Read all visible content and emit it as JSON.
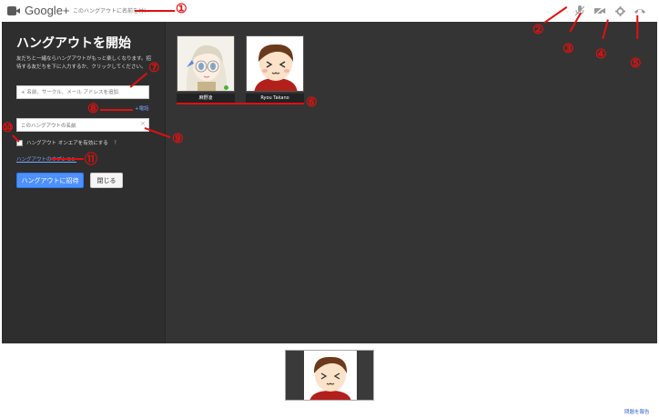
{
  "app": {
    "brand": "Google+"
  },
  "topbar": {
    "title_placeholder": "このハングアウトに名前を付ける",
    "dots": "· · · · · ·",
    "icons": [
      "microphone-off-icon",
      "camera-off-icon",
      "settings-gear-icon",
      "hangup-phone-icon"
    ]
  },
  "panel": {
    "title": "ハングアウトを開始",
    "description": "友だちと一緒ならハングアウトがもっと楽しくなります。招待する友だちを下に入力するか、クリックしてください。",
    "invite_placeholder": "+ 名前、サークル、メール アドレスを追加",
    "phone_link": "+電話",
    "name_value": "このハングアウトの名前",
    "onair_label": "ハングアウト オンエアを有効にする",
    "onair_help": "?",
    "options_link": "ハングアウトのオプション",
    "invite_button": "ハングアウトに招待",
    "close_button": "閉じる"
  },
  "contacts": [
    {
      "name": "麻野凌",
      "avatar": "anime-girl-avatar",
      "online": true
    },
    {
      "name": "Ryou Takano",
      "avatar": "cartoon-boy-avatar",
      "online": false
    }
  ],
  "footer": {
    "report_link": "問題を報告"
  },
  "annotations": {
    "n1": "①",
    "n2": "②",
    "n3": "③",
    "n4": "④",
    "n5": "⑤",
    "n6": "⑥",
    "n7": "⑦",
    "n8": "⑧",
    "n9": "⑨",
    "n10": "⑩",
    "n11": "⑪"
  },
  "colors": {
    "annotation": "#e01010",
    "panel_bg": "#2e2e2e",
    "main_bg": "#343434",
    "accent": "#4d90fe",
    "link": "#7aa7ff"
  }
}
